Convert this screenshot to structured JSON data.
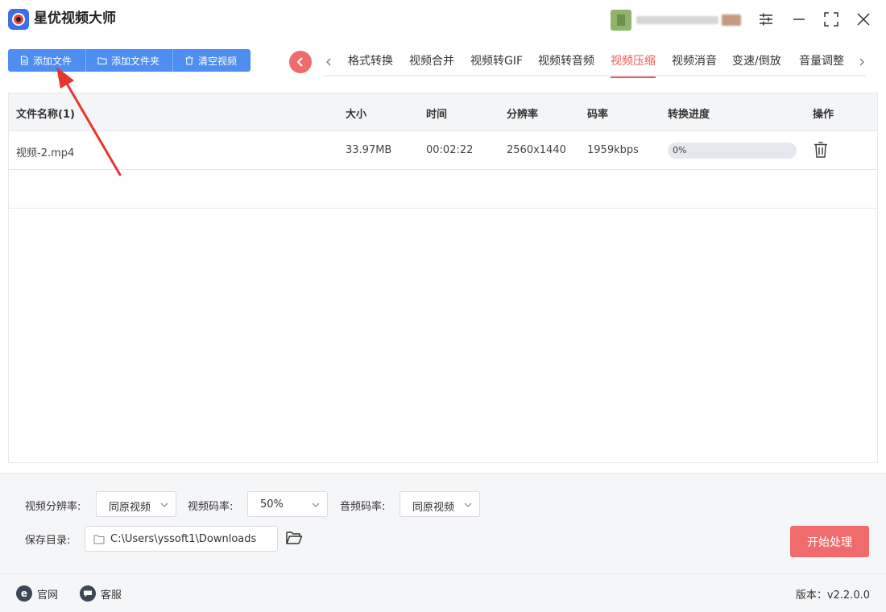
{
  "app": {
    "title": "星优视频大师"
  },
  "toolbar": {
    "add_file": "添加文件",
    "add_folder": "添加文件夹",
    "clear_videos": "清空视频"
  },
  "tabs": [
    {
      "label": "格式转换",
      "active": false
    },
    {
      "label": "视频合并",
      "active": false
    },
    {
      "label": "视频转GIF",
      "active": false
    },
    {
      "label": "视频转音频",
      "active": false
    },
    {
      "label": "视频压缩",
      "active": true
    },
    {
      "label": "视频消音",
      "active": false
    },
    {
      "label": "变速/倒放",
      "active": false
    },
    {
      "label": "音量调整",
      "active": false
    }
  ],
  "table": {
    "headers": {
      "name": "文件名称(1)",
      "size": "大小",
      "time": "时间",
      "resolution": "分辨率",
      "bitrate": "码率",
      "progress": "转换进度",
      "actions": "操作"
    },
    "rows": [
      {
        "name": "视频-2.mp4",
        "size": "33.97MB",
        "time": "00:02:22",
        "resolution": "2560x1440",
        "bitrate": "1959kbps",
        "progress_text": "0%",
        "progress": 0
      }
    ]
  },
  "settings": {
    "video_resolution_label": "视频分辨率:",
    "video_resolution_value": "同原视频",
    "video_bitrate_label": "视频码率:",
    "video_bitrate_value": "50%",
    "audio_bitrate_label": "音频码率:",
    "audio_bitrate_value": "同原视频",
    "save_dir_label": "保存目录:",
    "save_dir_value": "C:\\Users\\yssoft1\\Downloads",
    "start_button": "开始处理"
  },
  "statusbar": {
    "website": "官网",
    "support": "客服",
    "version": "版本：v2.2.0.0"
  },
  "colors": {
    "primary_blue": "#4d8ef0",
    "accent_red": "#f06b6b",
    "active_tab": "#e95858"
  }
}
